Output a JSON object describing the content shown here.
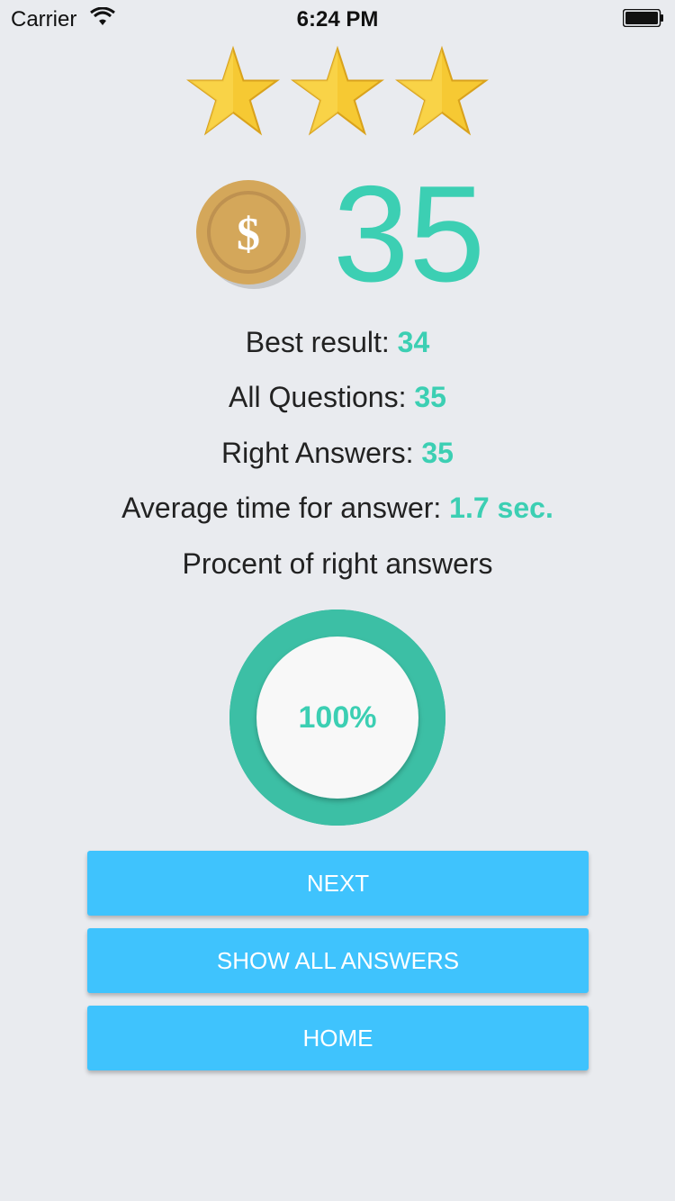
{
  "status_bar": {
    "carrier": "Carrier",
    "time": "6:24 PM"
  },
  "rating": {
    "stars_filled": 3,
    "stars_total": 3
  },
  "score": {
    "value": "35",
    "coin_icon": "coin-dollar-icon"
  },
  "stats": [
    {
      "label": "Best result: ",
      "value": "34"
    },
    {
      "label": "All Questions: ",
      "value": "35"
    },
    {
      "label": "Right Answers: ",
      "value": "35"
    },
    {
      "label": "Average time for answer: ",
      "value": "1.7 sec."
    }
  ],
  "percent_title": "Procent of right answers",
  "progress": {
    "fraction": 1.0,
    "label": "100%"
  },
  "buttons": {
    "next": "NEXT",
    "show_all": "SHOW ALL ANSWERS",
    "home": "HOME"
  },
  "colors": {
    "accent": "#3CCFB3",
    "ring": "#34B59C",
    "button": "#3FC3FD",
    "background": "#E9EBEF",
    "star": "#F6C933",
    "coin": "#D4A75A"
  }
}
